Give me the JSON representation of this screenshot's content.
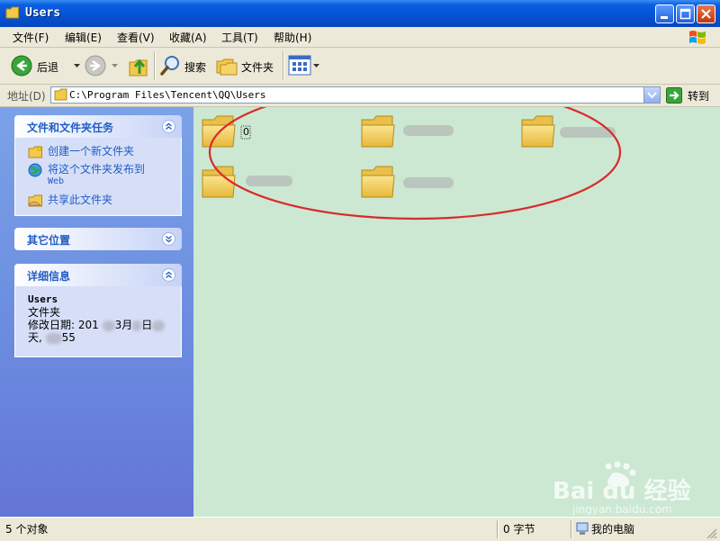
{
  "window": {
    "title": "Users"
  },
  "menu": [
    "文件(F)",
    "编辑(E)",
    "查看(V)",
    "收藏(A)",
    "工具(T)",
    "帮助(H)"
  ],
  "toolbar": {
    "back": "后退",
    "search": "搜索",
    "folders": "文件夹"
  },
  "address": {
    "label": "地址(D)",
    "path": "C:\\Program Files\\Tencent\\QQ\\Users",
    "go": "转到"
  },
  "tasks": {
    "title": "文件和文件夹任务",
    "items": [
      {
        "label": "创建一个新文件夹"
      },
      {
        "label": "将这个文件夹发布到",
        "sub": "Web"
      },
      {
        "label": "共享此文件夹"
      }
    ]
  },
  "other": {
    "title": "其它位置"
  },
  "details": {
    "title": "详细信息",
    "name": "Users",
    "type": "文件夹",
    "date_prefix": "修改日期: 201",
    "date_mid": "3月",
    "date_end": "日",
    "line3_prefix": "天,",
    "line3_end": "55"
  },
  "folders": [
    {
      "label": "0"
    },
    {
      "label": ""
    },
    {
      "label": ""
    },
    {
      "label": ""
    },
    {
      "label": ""
    }
  ],
  "status": {
    "objects": "5 个对象",
    "size": "0 字节",
    "location": "我的电脑"
  },
  "watermark": {
    "text": "Bai du 经验",
    "url": "jingyan.baidu.com"
  },
  "colors": {
    "title_bar": "#0553d6",
    "task_pane": "#6a8adf",
    "content_bg": "#cce8d2",
    "annotation": "#d92b2b"
  }
}
